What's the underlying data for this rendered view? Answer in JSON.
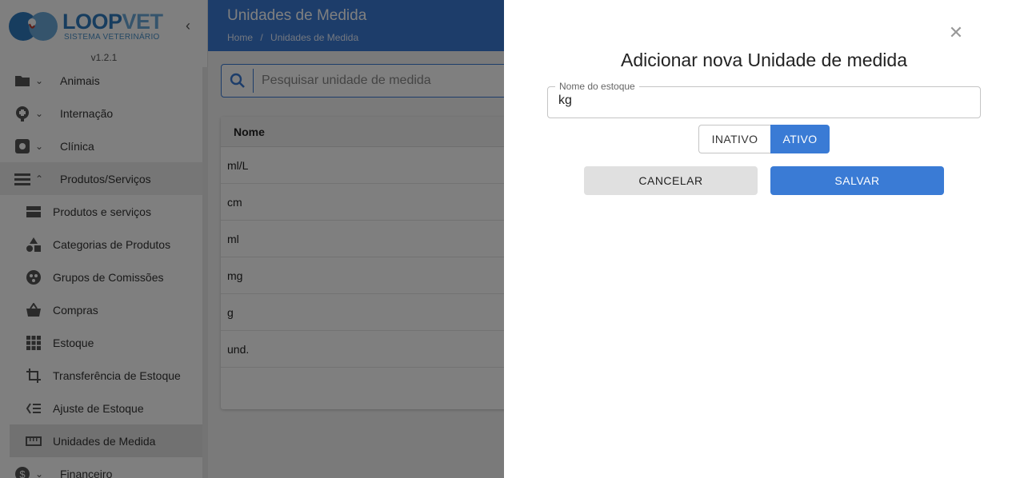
{
  "sidebar": {
    "logo": {
      "brand_a": "LOOP",
      "brand_b": "VET",
      "subtitle": "SISTEMA VETERINÁRIO"
    },
    "version": "v1.2.1",
    "items": [
      {
        "label": "Animais",
        "icon": "folder-icon"
      },
      {
        "label": "Internação",
        "icon": "hospital-icon"
      },
      {
        "label": "Clínica",
        "icon": "medical-kit-icon"
      },
      {
        "label": "Produtos/Serviços",
        "icon": "list-icon"
      }
    ],
    "sub_items": [
      {
        "label": "Produtos e serviços",
        "icon": "product-icon"
      },
      {
        "label": "Categorias de Produtos",
        "icon": "category-icon"
      },
      {
        "label": "Grupos de Comissões",
        "icon": "group-icon"
      },
      {
        "label": "Compras",
        "icon": "basket-icon"
      },
      {
        "label": "Estoque",
        "icon": "grid-icon"
      },
      {
        "label": "Transferência de Estoque",
        "icon": "transfer-icon"
      },
      {
        "label": "Ajuste de Estoque",
        "icon": "adjust-icon"
      },
      {
        "label": "Unidades de Medida",
        "icon": "ruler-icon"
      }
    ],
    "bottom_item": {
      "label": "Financeiro",
      "icon": "dollar-icon"
    }
  },
  "header": {
    "title": "Unidades de Medida",
    "breadcrumb": [
      "Home",
      "Unidades de Medida"
    ],
    "breadcrumb_sep": "/"
  },
  "search": {
    "placeholder": "Pesquisar unidade de medida",
    "value": ""
  },
  "table": {
    "header": "Nome",
    "rows": [
      "ml/L",
      "cm",
      "ml",
      "mg",
      "g",
      "und."
    ]
  },
  "drawer": {
    "title": "Adicionar nova Unidade de medida",
    "close_symbol": "✕",
    "field_label": "Nome do estoque",
    "field_value": "kg",
    "toggle": {
      "off_label": "INATIVO",
      "on_label": "ATIVO",
      "selected": "ATIVO"
    },
    "cancel_label": "CANCELAR",
    "save_label": "SALVAR"
  },
  "colors": {
    "primary": "#3a7bd5",
    "brand": "#2e7bbf",
    "overlay": "rgba(0,0,0,0.5)"
  }
}
